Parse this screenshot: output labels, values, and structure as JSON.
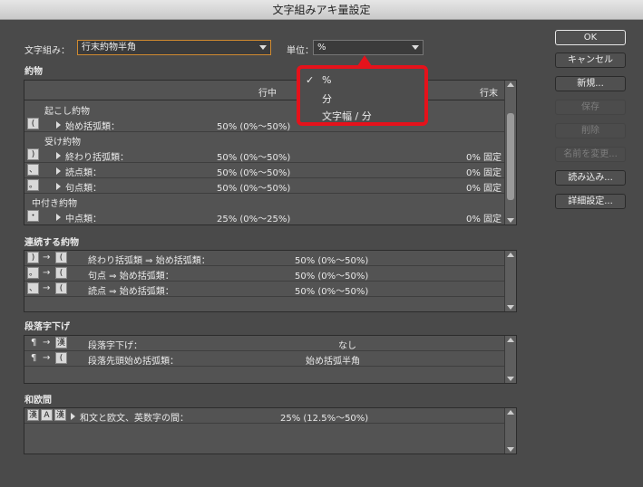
{
  "window": {
    "title": "文字組みアキ量設定"
  },
  "top": {
    "mojikumi_label": "文字組み：",
    "mojikumi_value": "行末約物半角",
    "unit_label": "単位：",
    "unit_value": "%"
  },
  "unit_menu": {
    "options": [
      "%",
      "分",
      "文字幅 / 分"
    ],
    "selected": "%"
  },
  "buttons": {
    "ok": "OK",
    "cancel": "キャンセル",
    "new": "新規...",
    "save": "保存",
    "delete": "削除",
    "rename": "名前を変更...",
    "load": "読み込み...",
    "detail": "詳細設定..."
  },
  "yakumono": {
    "title": "約物",
    "col_center": "行中",
    "col_end": "行末",
    "groups": [
      {
        "label": "起こし約物",
        "rows": [
          {
            "icon": "(",
            "name": "始め括弧類：",
            "mid": "50% (0%〜50%)",
            "end": ""
          }
        ]
      },
      {
        "label": "受け約物",
        "rows": [
          {
            "icon": ")",
            "name": "終わり括弧類：",
            "mid": "50% (0%〜50%)",
            "end": "0% 固定"
          },
          {
            "icon": "、",
            "name": "読点類：",
            "mid": "50% (0%〜50%)",
            "end": "0% 固定"
          },
          {
            "icon": "。",
            "name": "句点類：",
            "mid": "50% (0%〜50%)",
            "end": "0% 固定"
          }
        ]
      },
      {
        "label": "中付き約物",
        "rows": [
          {
            "icon": "・",
            "name": "中点類：",
            "mid": "25% (0%〜25%)",
            "end": "0% 固定"
          }
        ]
      }
    ]
  },
  "continuous": {
    "title": "連続する約物",
    "rows": [
      {
        "icon_a": ")",
        "icon_b": "(",
        "name": "終わり括弧類 ⇒ 始め括弧類：",
        "value": "50% (0%〜50%)"
      },
      {
        "icon_a": "。",
        "icon_b": "(",
        "name": "句点 ⇒ 始め括弧類：",
        "value": "50% (0%〜50%)"
      },
      {
        "icon_a": "、",
        "icon_b": "(",
        "name": "読点 ⇒ 始め括弧類：",
        "value": "50% (0%〜50%)"
      }
    ]
  },
  "indent": {
    "title": "段落字下げ",
    "rows": [
      {
        "icon_a": "¶",
        "icon_b": "漢",
        "name": "段落字下げ：",
        "value": "なし"
      },
      {
        "icon_a": "¶",
        "icon_b": "(",
        "name": "段落先頭始め括弧類：",
        "value": "始め括弧半角"
      }
    ]
  },
  "wa_ou": {
    "title": "和欧間",
    "row": {
      "icon_a": "漢",
      "icon_b": "A",
      "icon_c": "漢",
      "name": "和文と欧文、英数字の間：",
      "value": "25% (12.5%〜50%)"
    }
  },
  "arrow_glyph": "→"
}
